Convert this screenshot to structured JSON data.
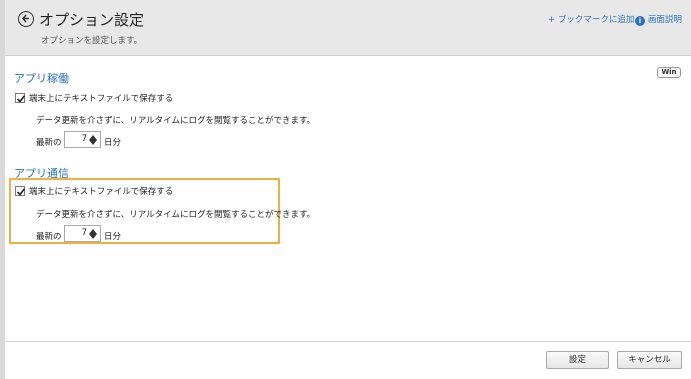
{
  "header": {
    "title": "オプション設定",
    "subtitle": "オプションを設定します。",
    "bookmark_link": "+ ブックマークに追加",
    "help_link": "画面説明",
    "help_icon_glyph": "i"
  },
  "badge": {
    "label": "Win"
  },
  "sections": [
    {
      "title": "アプリ稼働",
      "checkbox_label": "端末上にテキストファイルで保存する",
      "checked": true,
      "description": "データ更新を介さずに、リアルタイムにログを閲覧することができます。",
      "latest_label": "最新の",
      "days_value": "7",
      "days_unit": "日分"
    },
    {
      "title": "アプリ通信",
      "checkbox_label": "端末上にテキストファイルで保存する",
      "checked": true,
      "description": "データ更新を介さずに、リアルタイムにログを閲覧することができます。",
      "latest_label": "最新の",
      "days_value": "7",
      "days_unit": "日分"
    }
  ],
  "footer": {
    "save_label": "設定",
    "cancel_label": "キャンセル"
  },
  "colors": {
    "accent": "#2b72c4",
    "highlight": "#f0b040",
    "header_bg": "#e8e8e8"
  }
}
